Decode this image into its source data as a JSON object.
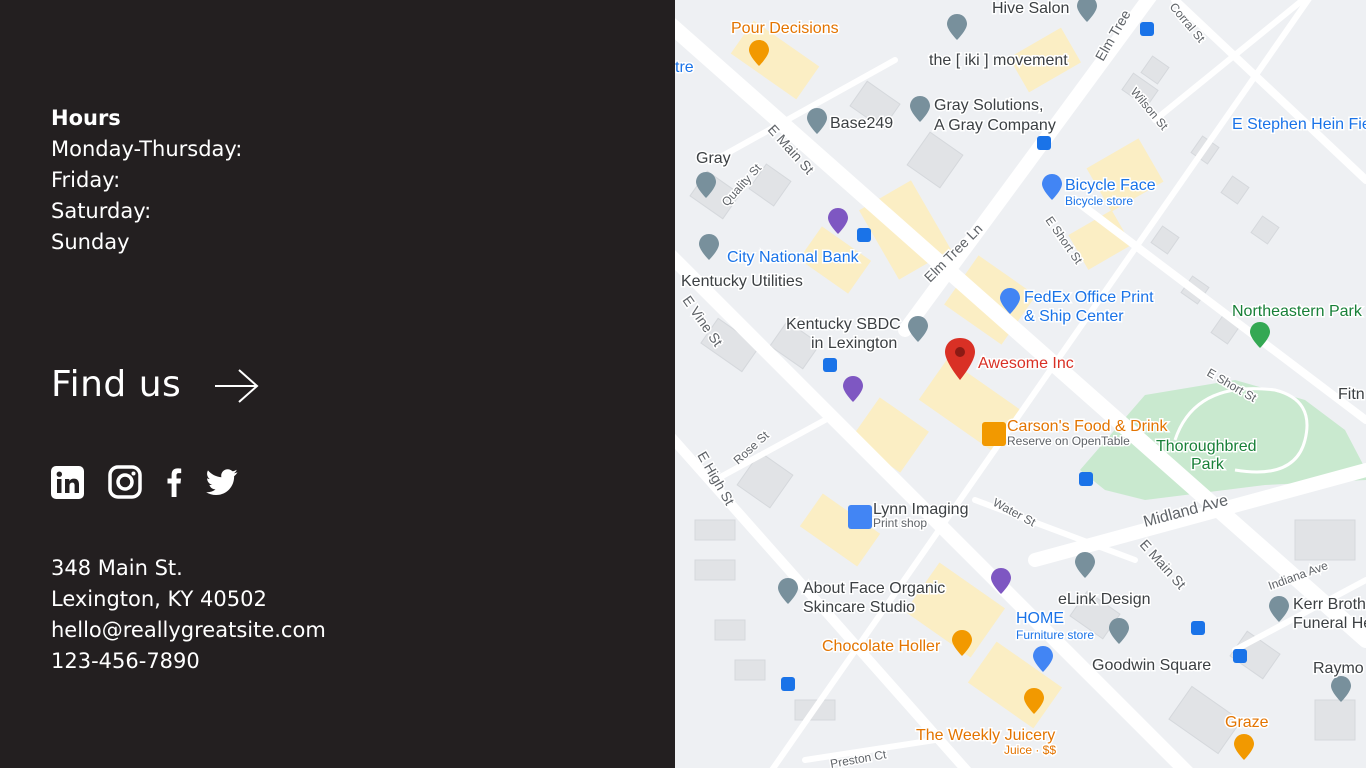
{
  "hours": {
    "title": "Hours",
    "rows": [
      "Monday-Thursday:",
      "Friday:",
      "Saturday:",
      "Sunday"
    ]
  },
  "find_us": {
    "label": "Find us",
    "icon": "arrow-right-icon"
  },
  "social": [
    {
      "name": "linkedin-icon"
    },
    {
      "name": "instagram-icon"
    },
    {
      "name": "facebook-icon"
    },
    {
      "name": "twitter-icon"
    }
  ],
  "contact": {
    "street": "348 Main St.",
    "city": "Lexington, KY 40502",
    "email": "hello@reallygreatsite.com",
    "phone": "123-456-7890"
  },
  "map": {
    "places": {
      "hive_salon": "Hive Salon",
      "pour_decisions": "Pour Decisions",
      "iki": "the [ iki ] movement",
      "gray_solutions_1": "Gray Solutions,",
      "gray_solutions_2": "A Gray Company",
      "base249": "Base249",
      "gray": "Gray",
      "bicycle_face": "Bicycle Face",
      "bicycle_face_sub": "Bicycle store",
      "city_national": "City National Bank",
      "kentucky_utilities": "Kentucky Utilities",
      "fedex_1": "FedEx Office Print",
      "fedex_2": "& Ship Center",
      "sbdc_1": "Kentucky SBDC",
      "sbdc_2": "in Lexington",
      "awesome": "Awesome Inc",
      "northeastern": "Northeastern Park",
      "carsons": "Carson's Food & Drink",
      "carsons_sub": "Reserve on OpenTable",
      "thoroughbred_1": "Thoroughbred",
      "thoroughbred_2": "Park",
      "lynn": "Lynn Imaging",
      "lynn_sub": "Print shop",
      "about_face_1": "About Face Organic",
      "about_face_2": "Skincare Studio",
      "elink": "eLink Design",
      "home": "HOME",
      "home_sub": "Furniture store",
      "goodwin": "Goodwin Square",
      "chocolate": "Chocolate Holler",
      "weekly_juicery": "The Weekly Juicery",
      "weekly_sub": "Juice · $$",
      "graze": "Graze",
      "kerr_1": "Kerr Broth",
      "kerr_2": "Funeral He",
      "raymo": "Raymo",
      "fitn": "Fitn",
      "stephen": "E Stephen Hein Fie",
      "tre": "tre"
    },
    "streets": {
      "elm_tree_ln": "Elm Tree Ln",
      "elm_tree_top": "Elm Tree",
      "e_main": "E Main St",
      "e_main_2": "E Main St",
      "quality": "Quality St",
      "wilson": "Wilson St",
      "corral": "Corral St",
      "e_short": "E Short St",
      "e_short_2": "E Short St",
      "e_vine": "E Vine St",
      "e_high": "E High St",
      "rose": "Rose St",
      "water": "Water St",
      "midland": "Midland Ave",
      "indiana": "Indiana Ave",
      "preston": "Preston Ct"
    },
    "colors": {
      "road": "#ffffff",
      "building": "#e3e5e8",
      "commercial": "#fbeec4",
      "park": "#c9e9cf",
      "text_blue": "#1a73e8",
      "text_orange": "#e37400",
      "pin_red": "#d93025",
      "pin_gray": "#78909c"
    }
  }
}
